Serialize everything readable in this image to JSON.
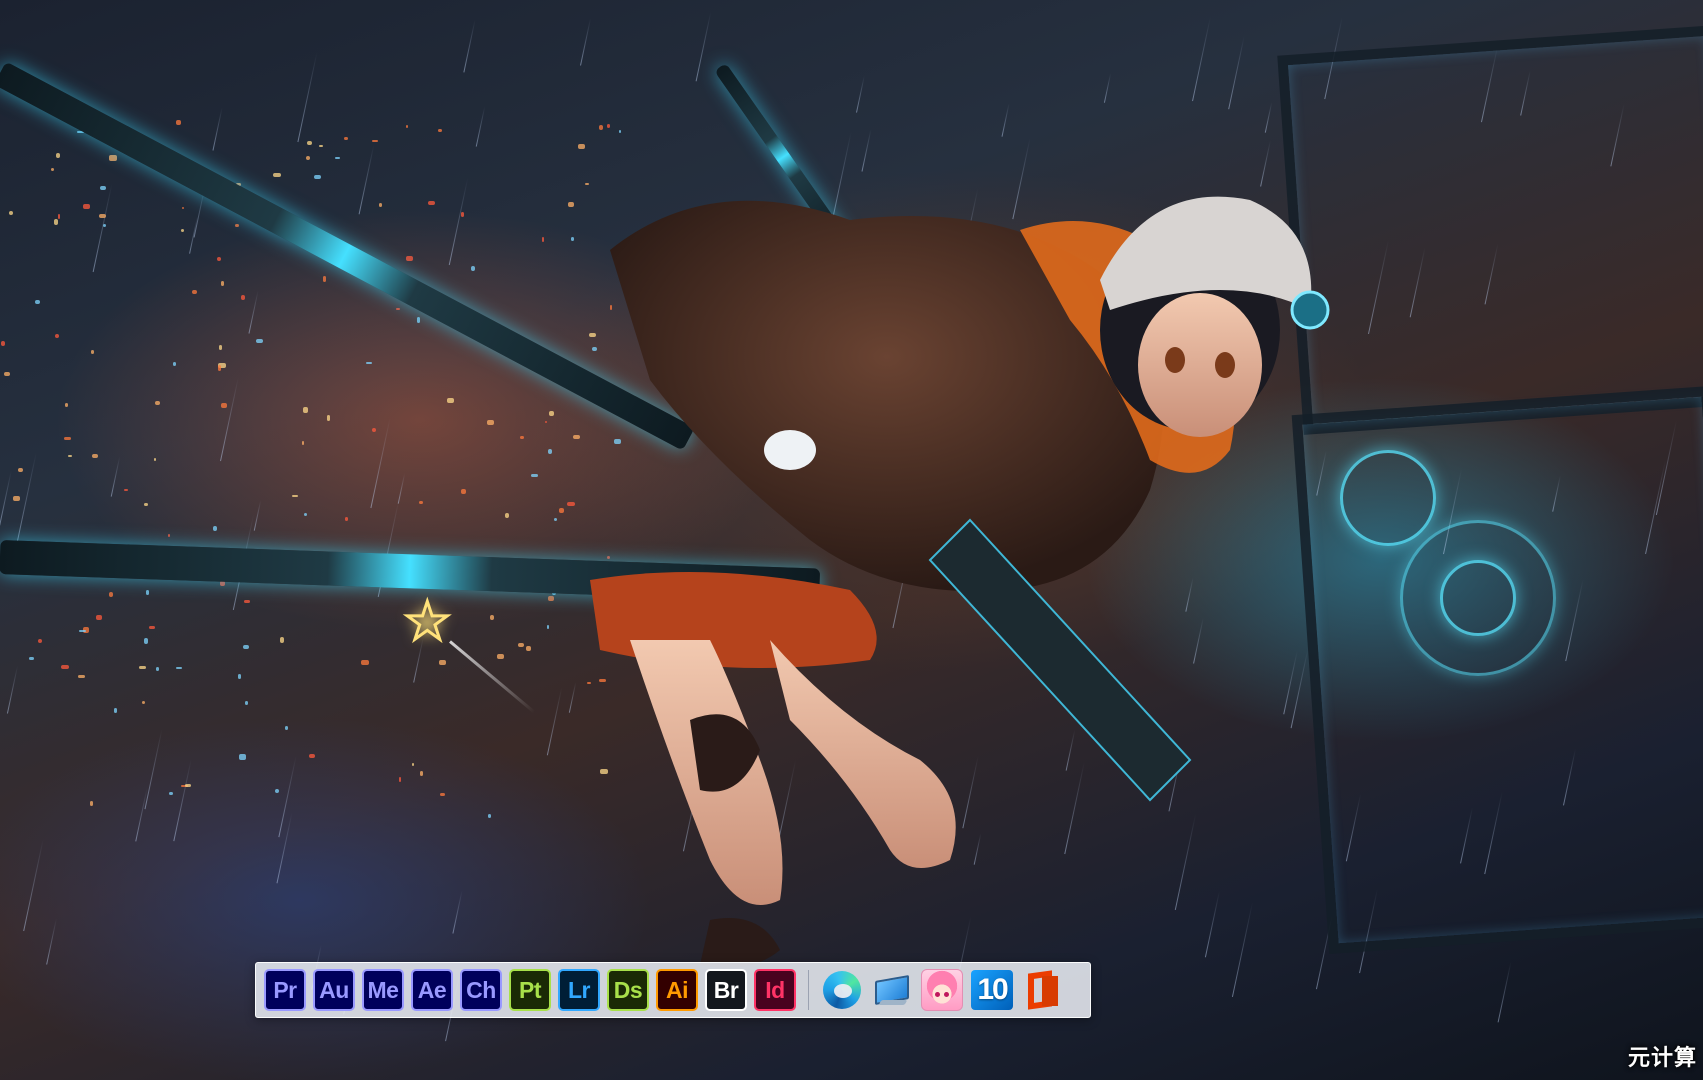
{
  "desktop": {
    "wallpaper": "anime-girl-swords-rainy-city-wallpaper",
    "watermark": "元计算"
  },
  "dock": {
    "apps": [
      {
        "abbr": "Pr",
        "name": "premiere-pro",
        "bg": "#00005b",
        "fg": "#9999ff"
      },
      {
        "abbr": "Au",
        "name": "audition",
        "bg": "#00005b",
        "fg": "#9999ff"
      },
      {
        "abbr": "Me",
        "name": "media-encoder",
        "bg": "#00005b",
        "fg": "#9999ff"
      },
      {
        "abbr": "Ae",
        "name": "after-effects",
        "bg": "#00005b",
        "fg": "#9999ff"
      },
      {
        "abbr": "Ch",
        "name": "character-animator",
        "bg": "#00005b",
        "fg": "#9999ff"
      },
      {
        "abbr": "Pt",
        "name": "substance-painter",
        "bg": "#1a2a05",
        "fg": "#a8e04a"
      },
      {
        "abbr": "Lr",
        "name": "lightroom",
        "bg": "#001e36",
        "fg": "#31a8ff"
      },
      {
        "abbr": "Ds",
        "name": "substance-designer",
        "bg": "#1a2a05",
        "fg": "#a8e04a"
      },
      {
        "abbr": "Ai",
        "name": "illustrator",
        "bg": "#330000",
        "fg": "#ff9a00"
      },
      {
        "abbr": "Br",
        "name": "bridge",
        "bg": "#13171d",
        "fg": "#ffffff"
      },
      {
        "abbr": "Id",
        "name": "indesign",
        "bg": "#49021f",
        "fg": "#ff3366"
      }
    ],
    "system": {
      "win10_label": "10"
    }
  }
}
